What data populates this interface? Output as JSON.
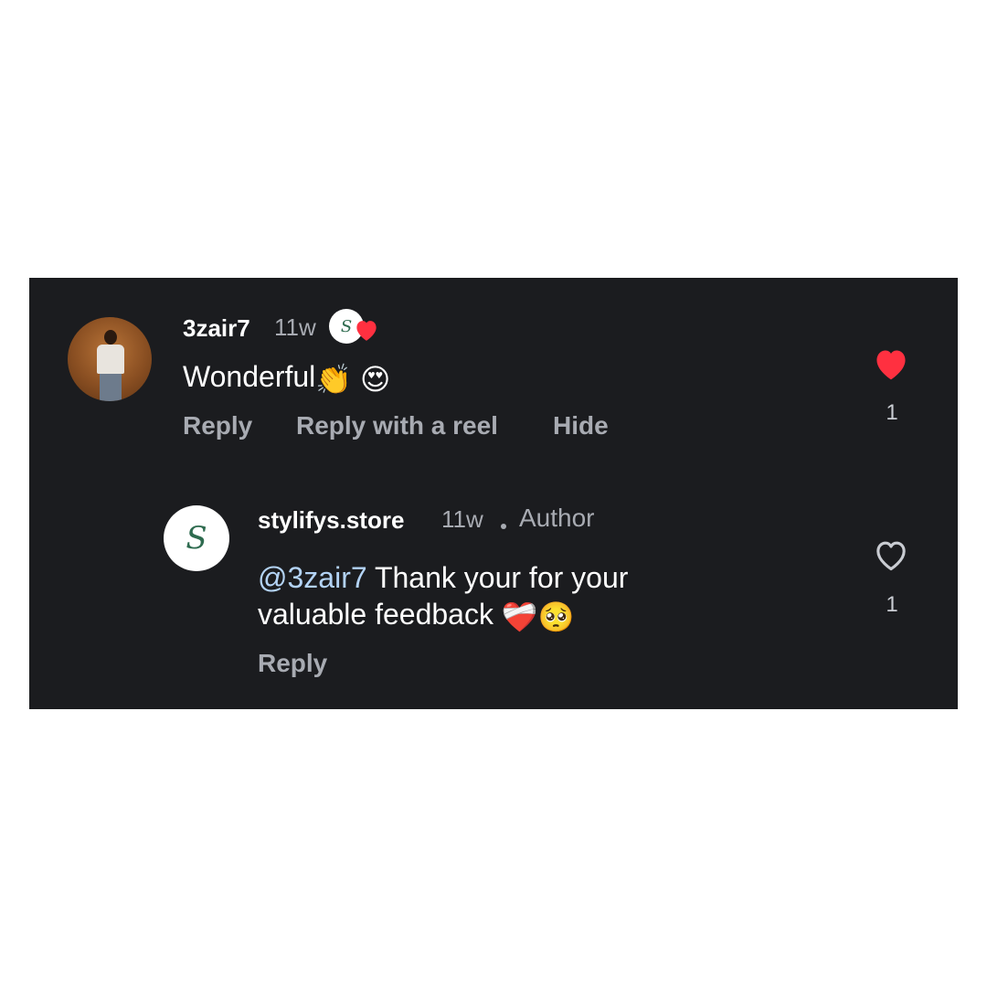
{
  "comment": {
    "username": "3zair7",
    "time": "11w",
    "text": "Wonderful",
    "emoji_clap": "👏",
    "emoji_heart_eyes": "😍",
    "actions": {
      "reply": "Reply",
      "reply_with_reel": "Reply with a reel",
      "hide": "Hide"
    },
    "like_count": "1",
    "liked": true,
    "liked_by_author_icon": "author-heart-badge-icon"
  },
  "reply": {
    "username": "stylifys.store",
    "time": "11w",
    "author_label": "Author",
    "mention": "@3zair7",
    "text_line1": "Thank your for your",
    "text_line2": "valuable feedback",
    "emoji_mending_heart": "❤️‍🩹",
    "emoji_pleading": "🥺",
    "actions": {
      "reply": "Reply"
    },
    "like_count": "1",
    "liked": false
  },
  "colors": {
    "background": "#1b1c1f",
    "like_red": "#ff3040",
    "muted": "#a8abb2",
    "mention": "#b3d3f5",
    "logo_green": "#2e6b4f"
  }
}
